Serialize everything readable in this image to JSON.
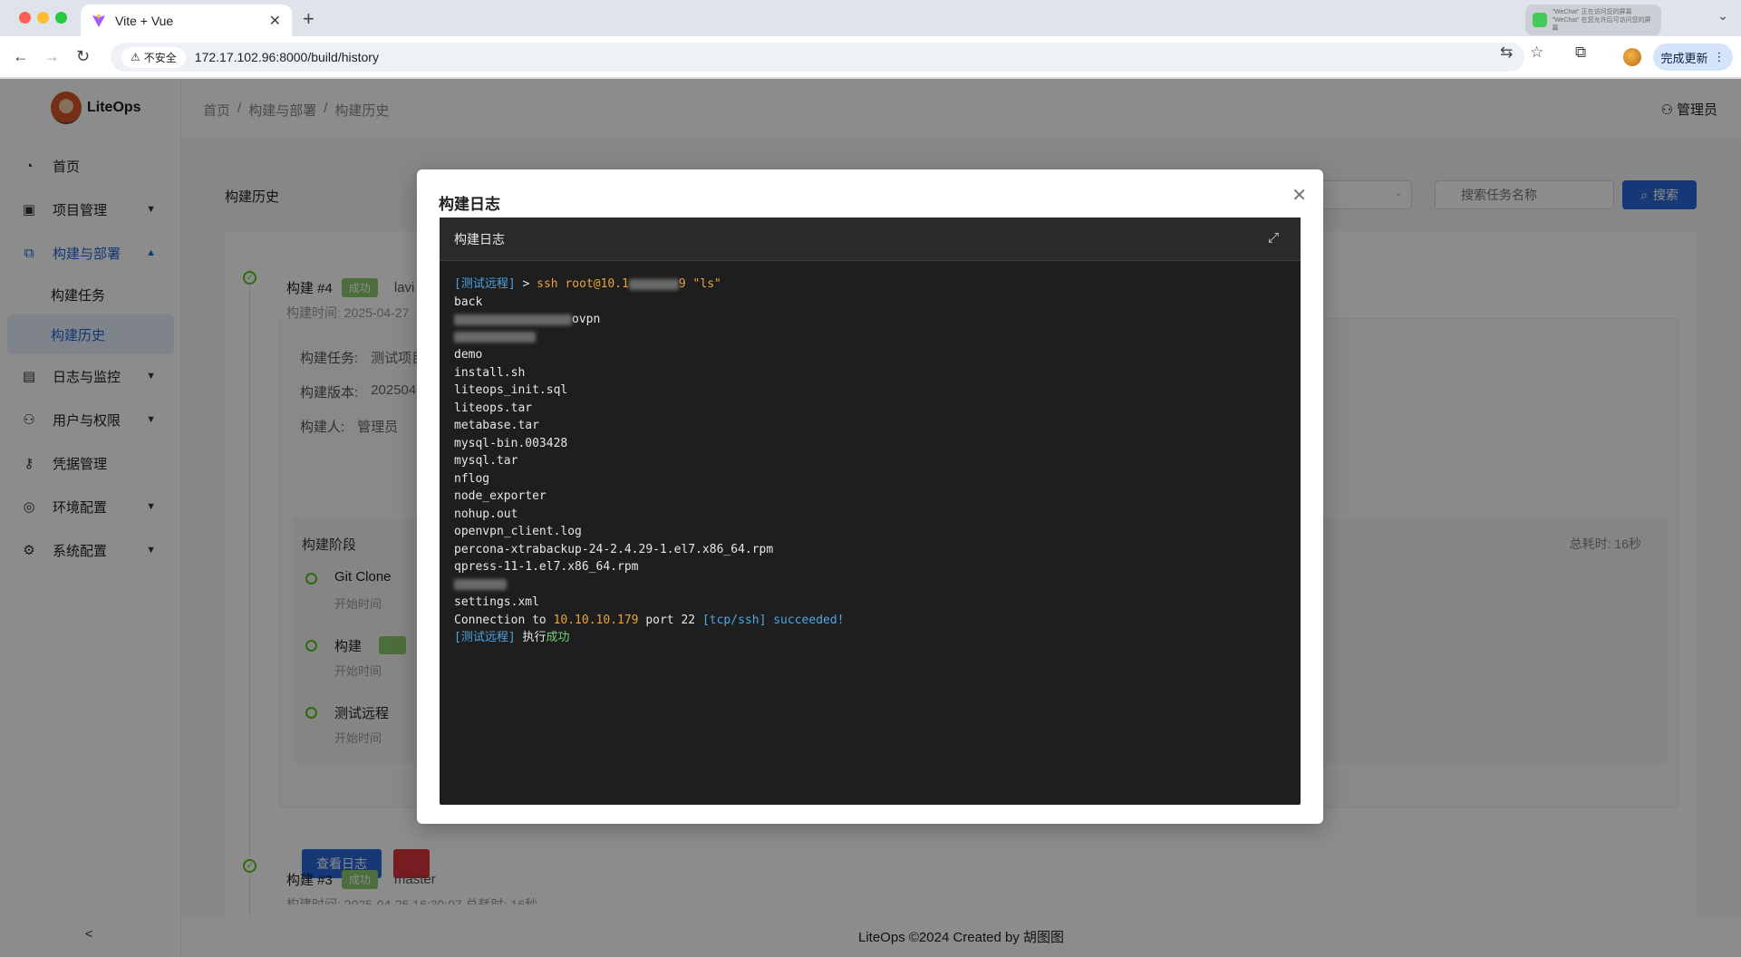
{
  "browser": {
    "tab_title": "Vite + Vue",
    "url": "172.17.102.96:8000/build/history",
    "insecure_label": "不安全",
    "update_label": "完成更新",
    "notification_line1": "\"WeChat\" 正在访问您的屏幕",
    "notification_line2": "\"WeChat\" 在您允许后可访问您的屏幕"
  },
  "app": {
    "logo_text": "LiteOps",
    "breadcrumb": [
      "首页",
      "构建与部署",
      "构建历史"
    ],
    "user_label": "管理员",
    "sidebar": {
      "items": [
        {
          "label": "首页",
          "icon": "dashboard-icon"
        },
        {
          "label": "项目管理",
          "icon": "project-icon"
        },
        {
          "label": "构建与部署",
          "icon": "build-icon"
        },
        {
          "label": "日志与监控",
          "icon": "log-icon"
        },
        {
          "label": "用户与权限",
          "icon": "user-icon"
        },
        {
          "label": "凭据管理",
          "icon": "key-icon"
        },
        {
          "label": "环境配置",
          "icon": "env-icon"
        },
        {
          "label": "系统配置",
          "icon": "settings-icon"
        }
      ],
      "sub_items": [
        "构建任务",
        "构建历史"
      ]
    },
    "page_title": "构建历史",
    "search": {
      "placeholder": "搜索任务名称",
      "button": "搜索"
    },
    "builds": [
      {
        "number": "构建 #4",
        "status": "成功",
        "branch": "lavi",
        "time": "构建时间: 2025-04-27",
        "task_label": "构建任务:",
        "task_value": "测试项目",
        "version_label": "构建版本:",
        "version_value": "202504",
        "builder_label": "构建人:",
        "builder_value": "管理员",
        "stages_title": "构建阶段",
        "total_time": "总耗时: 16秒",
        "stages": [
          {
            "name": "Git Clone",
            "sub": "开始时间"
          },
          {
            "name": "构建",
            "sub": "开始时间"
          },
          {
            "name": "测试远程",
            "sub": "开始时间"
          }
        ],
        "view_log_button": "查看日志"
      },
      {
        "number": "构建 #3",
        "status": "成功",
        "branch": "master",
        "time": "构建时间: 2025-04-25 16:30:07      总耗时: 16秒"
      }
    ],
    "footer": "LiteOps ©2024 Created by 胡图图"
  },
  "modal": {
    "title": "构建日志",
    "terminal_title": "构建日志",
    "log": {
      "prompt_tag": "[测试远程]",
      "prompt_arrow": " > ",
      "command_prefix": "ssh root@10.1",
      "command_suffix": "9 \"ls\"",
      "lines": [
        "back",
        "ovpn",
        "demo",
        "install.sh",
        "liteops_init.sql",
        "liteops.tar",
        "metabase.tar",
        "mysql-bin.003428",
        "mysql.tar",
        "nflog",
        "node_exporter",
        "nohup.out",
        "openvpn_client.log",
        "percona-xtrabackup-24-2.4.29-1.el7.x86_64.rpm",
        "qpress-11-1.el7.x86_64.rpm",
        "settings.xml"
      ],
      "conn_prefix": "Connection to ",
      "conn_ip": "10.10.10.179",
      "conn_mid": " port 22 ",
      "conn_proto": "[tcp/ssh]",
      "conn_status": " succeeded!",
      "final_tag": "[测试远程]",
      "final_text": " 执行",
      "final_status": "成功"
    }
  },
  "colors": {
    "primary": "#2a66d8",
    "success": "#52c41a",
    "terminal_bg": "#1e1e1e",
    "log_tag": "#4aa3e6",
    "log_command": "#e8a33d",
    "log_success": "#6fd07a"
  }
}
